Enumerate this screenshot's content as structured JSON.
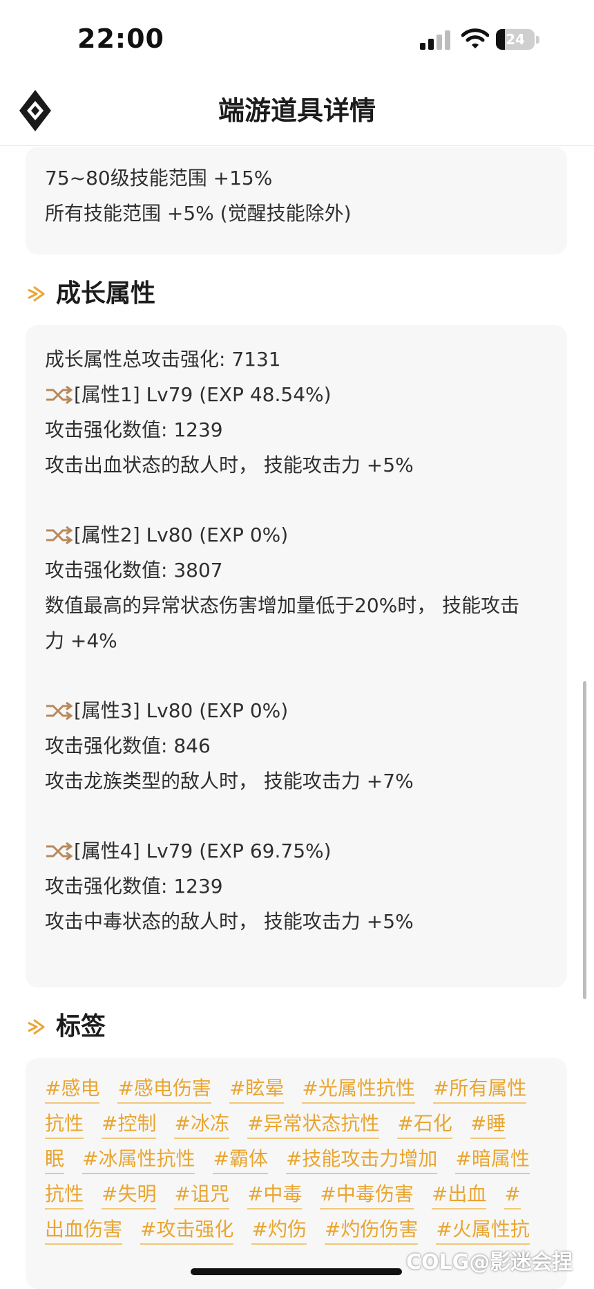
{
  "status_bar": {
    "time": "22:00",
    "battery": "24",
    "battery_level": 0.24
  },
  "header": {
    "title": "端游道具详情",
    "logo_icon": "diamond-logo-icon"
  },
  "top_card": {
    "lines": [
      "75~80级技能范围 +15%",
      "所有技能范围 +5% (觉醒技能除外)"
    ]
  },
  "growth_section": {
    "title": "成长属性",
    "total": "成长属性总攻击强化: 7131",
    "attributes": [
      {
        "head": "[属性1] Lv79 (EXP 48.54%)",
        "value": "攻击强化数值: 1239",
        "effect": "攻击出血状态的敌人时， 技能攻击力 +5%"
      },
      {
        "head": "[属性2] Lv80 (EXP 0%)",
        "value": "攻击强化数值: 3807",
        "effect_line1": "数值最高的异常状态伤害增加量低于20%时， 技能攻击",
        "effect_line2": "力 +4%"
      },
      {
        "head": "[属性3] Lv80 (EXP 0%)",
        "value": "攻击强化数值: 846",
        "effect": "攻击龙族类型的敌人时， 技能攻击力 +7%"
      },
      {
        "head": "[属性4] Lv79 (EXP 69.75%)",
        "value": "攻击强化数值: 1239",
        "effect": "攻击中毒状态的敌人时， 技能攻击力 +5%"
      }
    ]
  },
  "tags_section": {
    "title": "标签",
    "rows": [
      [
        "#感电",
        "#感电伤害",
        "#眩晕",
        "#光属性抗性",
        "#所有属性"
      ],
      [
        "抗性",
        "#控制",
        "#冰冻",
        "#异常状态抗性",
        "#石化",
        "#睡"
      ],
      [
        "眠",
        "#冰属性抗性",
        "#霸体",
        "#技能攻击力增加",
        "#暗属性"
      ],
      [
        "抗性",
        "#失明",
        "#诅咒",
        "#中毒",
        "#中毒伤害",
        "#出血",
        "#"
      ],
      [
        "出血伤害",
        "#攻击强化",
        "#灼伤",
        "#灼伤伤害",
        "#火属性抗"
      ]
    ]
  },
  "watermark": "COLG@影迷会捏",
  "colors": {
    "accent": "#e9a530",
    "card_bg": "#f7f7f7",
    "text": "#2f2f2f"
  }
}
